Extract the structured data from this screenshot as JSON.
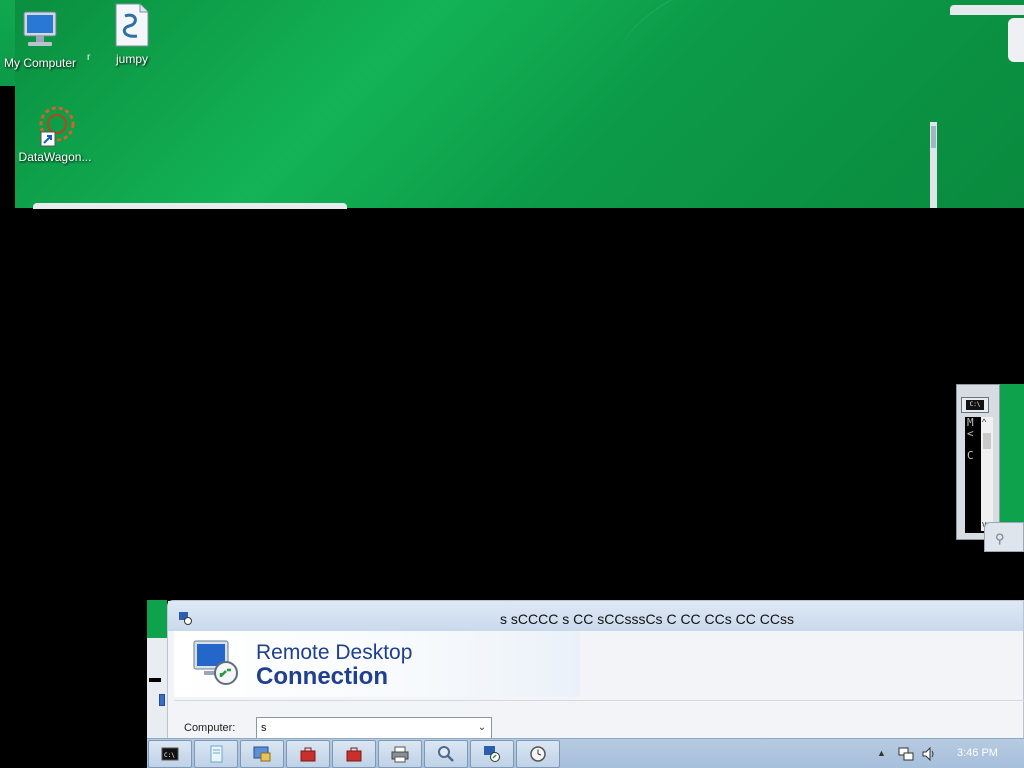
{
  "desktop": {
    "icons": [
      {
        "label": "My Computer",
        "icon": "computer-icon"
      },
      {
        "label": "jumpy",
        "icon": "script-file-icon"
      },
      {
        "label": "DataWagon...",
        "icon": "datawagon-shortcut-icon"
      }
    ],
    "stray_mark": "r"
  },
  "console": {
    "chars": [
      "M",
      "<",
      "",
      "C"
    ]
  },
  "rdc": {
    "title": "s sCCCC   s  CC sCCsssCs C CC CCs CC CCss",
    "brand_line1": "Remote Desktop",
    "brand_line2": "Connection",
    "computer_label": "Computer:",
    "computer_value": "s"
  },
  "taskbar": {
    "buttons": [
      {
        "icon": "cmd-icon"
      },
      {
        "icon": "notepad-icon"
      },
      {
        "icon": "remote-app-icon"
      },
      {
        "icon": "toolbox-red-icon"
      },
      {
        "icon": "toolbox-red-icon-2"
      },
      {
        "icon": "printer-icon"
      },
      {
        "icon": "magnifier-icon"
      },
      {
        "icon": "remote-desktop-icon"
      },
      {
        "icon": "clock-icon"
      }
    ],
    "clock": "3:46 PM"
  },
  "colors": {
    "desktop_green": "#13b356",
    "rdc_blue": "#1f3f8f",
    "taskbar": "#a6bfdb"
  }
}
